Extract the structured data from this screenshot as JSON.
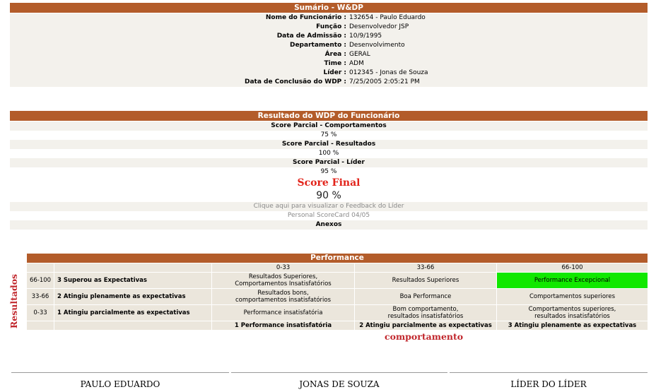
{
  "summary": {
    "title": "Sumário - W&DP",
    "fields": [
      {
        "label": "Nome do Funcionário :",
        "value": "132654 - Paulo Eduardo"
      },
      {
        "label": "Função :",
        "value": "Desenvolvedor JSP"
      },
      {
        "label": "Data de Admissão :",
        "value": "10/9/1995"
      },
      {
        "label": "Departamento :",
        "value": "Desenvolvimento"
      },
      {
        "label": "Área :",
        "value": "GERAL"
      },
      {
        "label": "Time :",
        "value": "ADM"
      },
      {
        "label": "Líder :",
        "value": "012345 - Jonas de Souza"
      },
      {
        "label": "Data de Conclusão do WDP :",
        "value": "7/25/2005 2:05:21 PM"
      }
    ]
  },
  "result": {
    "title": "Resultado do WDP do Funcionário",
    "partial_behaviors_label": "Score Parcial - Comportamentos",
    "partial_behaviors_value": "75 %",
    "partial_results_label": "Score Parcial - Resultados",
    "partial_results_value": "100 %",
    "partial_leader_label": "Score Parcial - Líder",
    "partial_leader_value": "95 %",
    "final_label": "Score Final",
    "final_value": "90 %",
    "feedback_link": "Clique aqui para visualizar o Feedback do Líder",
    "scorecard_link": "Personal ScoreCard 04/05",
    "attachments": "Anexos"
  },
  "performance": {
    "title": "Performance",
    "col_ranges": [
      "0-33",
      "33-66",
      "66-100"
    ],
    "rows": [
      {
        "range": "66-100",
        "label": "3 Superou as Expectativas",
        "cells": [
          "Resultados Superiores,\nComportamentos Insatisfatórios",
          "Resultados Superiores",
          "Performance Excepcional"
        ]
      },
      {
        "range": "33-66",
        "label": "2 Atingiu plenamente as expectativas",
        "cells": [
          "Resultados bons,\ncomportamentos insatisfatórios",
          "Boa Performance",
          "Comportamentos superiores"
        ]
      },
      {
        "range": "0-33",
        "label": "1 Atingiu parcialmente as expectativas",
        "cells": [
          "Performance insatisfatória",
          "Bom comportamento,\nresultados insatisfatórios",
          "Comportamentos superiores,\nresultados insatisfatórios"
        ]
      }
    ],
    "bottom_labels": [
      "1 Performance insatisfatória",
      "2 Atingiu parcialmente as expectativas",
      "3 Atingiu plenamente as expectativas"
    ],
    "y_axis_label": "Resultados",
    "x_axis_label": "comportamento",
    "highlight_color": "#11e800",
    "header_color": "#b35c2a"
  },
  "signatures": [
    "PAULO EDUARDO",
    "JONAS DE SOUZA",
    "LÍDER DO LÍDER"
  ]
}
